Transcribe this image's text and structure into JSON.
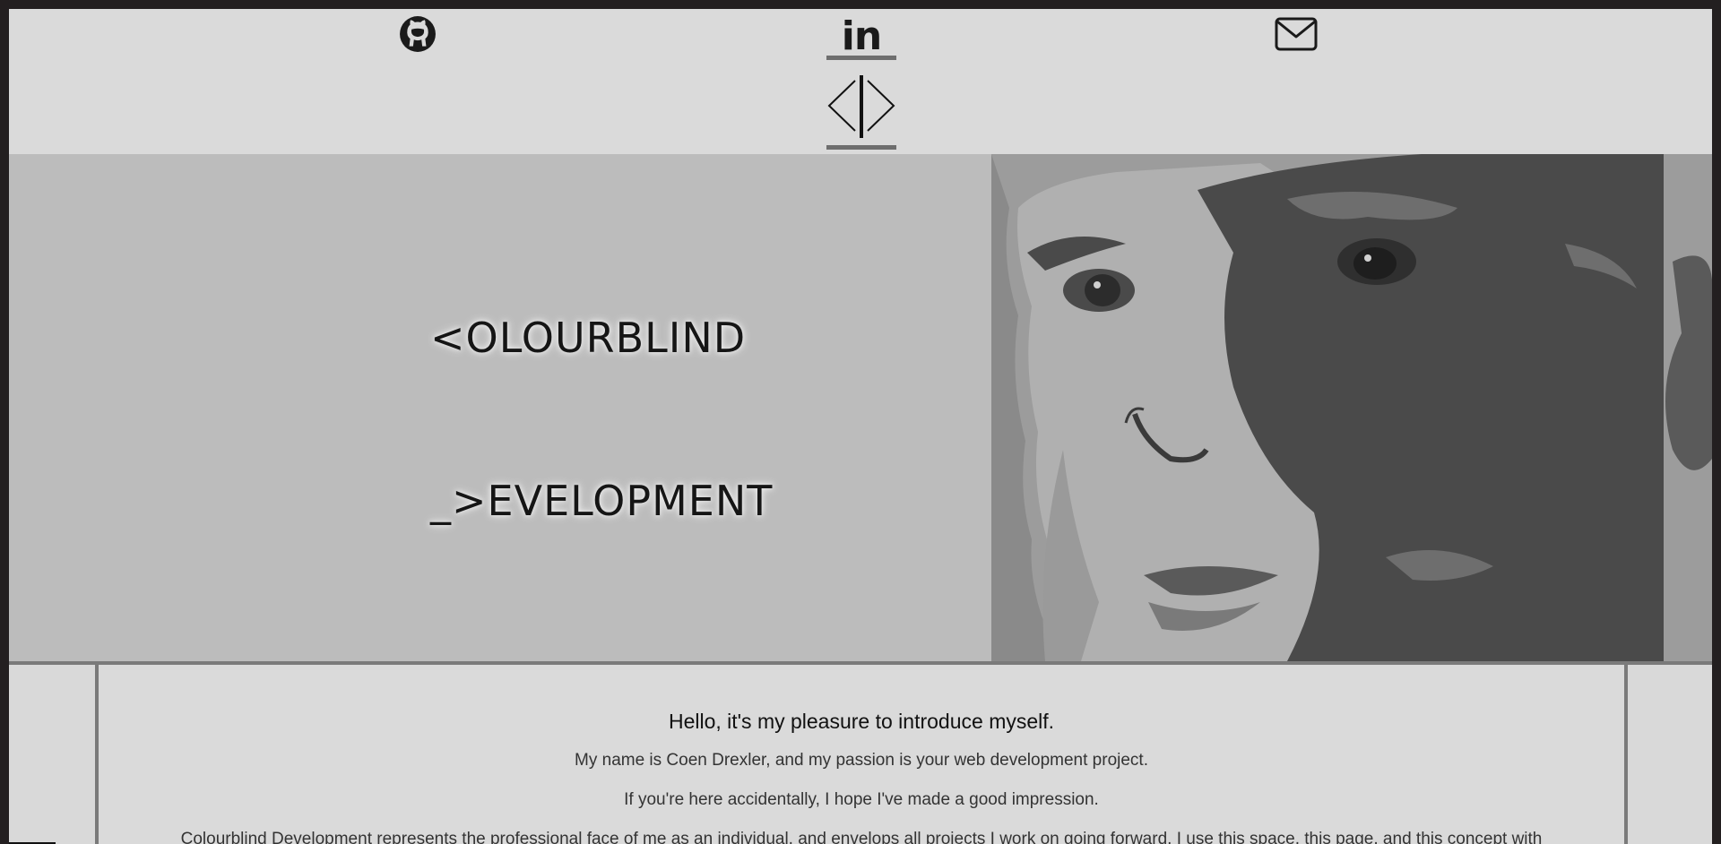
{
  "header": {
    "social": [
      {
        "icon": "github-icon",
        "label": "GitHub"
      },
      {
        "icon": "linkedin-icon",
        "label": "in"
      },
      {
        "icon": "mail-icon",
        "label": "Email"
      }
    ],
    "logo_icon": "code-brackets-logo"
  },
  "hero": {
    "line1": "<OLOURBLIND",
    "line2": "_>EVELOPMENT"
  },
  "about": {
    "heading": "Hello, it's my pleasure to introduce myself.",
    "paragraphs": [
      "My name is Coen Drexler, and my passion is your web development project.",
      "If you're here accidentally, I hope I've made a good impression.",
      "Colourblind Development represents the professional face of me as an individual, and envelops all projects I work on going forward. I use this space, this page, and this concept with"
    ]
  },
  "colors": {
    "frame": "#231f20",
    "header_bg": "#dadada",
    "hero_bg": "#bcbcbc",
    "rule": "#7a7a7a",
    "text_dark": "#151515"
  }
}
